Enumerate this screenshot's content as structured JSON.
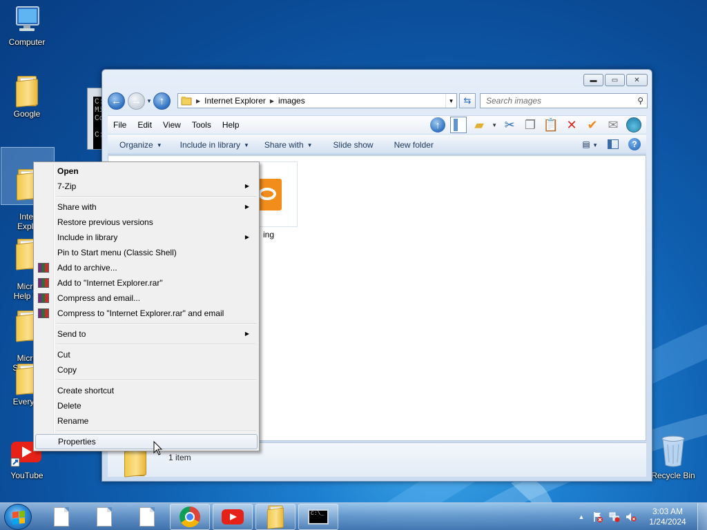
{
  "desktop": {
    "icons": [
      {
        "label": "Computer"
      },
      {
        "label": "Google"
      },
      {
        "label": "Intern\nExplo"
      },
      {
        "label": "Micros\nHelp Vi"
      },
      {
        "label": "Micros\nSQL Se"
      },
      {
        "label": "Everyth"
      },
      {
        "label": "YouTube"
      },
      {
        "label": "Recycle Bin"
      }
    ]
  },
  "console": {
    "text": "C:\\\nMi\nCo\n\nC:"
  },
  "explorer": {
    "window_buttons": {
      "minimize": "▬",
      "maximize": "▭",
      "close": "✕"
    },
    "address": {
      "crumbs": [
        "Internet Explorer",
        "images"
      ]
    },
    "search": {
      "placeholder": "Search images"
    },
    "menu": [
      "File",
      "Edit",
      "View",
      "Tools",
      "Help"
    ],
    "commands": [
      {
        "label": "Organize",
        "dropdown": true
      },
      {
        "label": "Include in library",
        "dropdown": true
      },
      {
        "label": "Share with",
        "dropdown": true
      },
      {
        "label": "Slide show",
        "dropdown": false
      },
      {
        "label": "New folder",
        "dropdown": false
      }
    ],
    "file": {
      "label": "ing"
    },
    "details": {
      "text": "1 item"
    }
  },
  "context_menu": {
    "items": [
      {
        "label": "Open",
        "bold": true
      },
      {
        "label": "7-Zip",
        "submenu": true
      },
      {
        "sep": true
      },
      {
        "label": "Share with",
        "submenu": true
      },
      {
        "label": "Restore previous versions"
      },
      {
        "label": "Include in library",
        "submenu": true
      },
      {
        "label": "Pin to Start menu (Classic Shell)"
      },
      {
        "label": "Add to archive...",
        "icon": "winrar-icon"
      },
      {
        "label": "Add to \"Internet Explorer.rar\"",
        "icon": "winrar-icon"
      },
      {
        "label": "Compress and email...",
        "icon": "winrar-icon"
      },
      {
        "label": "Compress to \"Internet Explorer.rar\" and email",
        "icon": "winrar-icon"
      },
      {
        "sep": true
      },
      {
        "label": "Send to",
        "submenu": true
      },
      {
        "sep": true
      },
      {
        "label": "Cut"
      },
      {
        "label": "Copy"
      },
      {
        "sep": true
      },
      {
        "label": "Create shortcut"
      },
      {
        "label": "Delete"
      },
      {
        "label": "Rename"
      },
      {
        "sep": true
      },
      {
        "label": "Properties",
        "highlighted": true
      }
    ]
  },
  "taskbar": {
    "clock": {
      "time": "3:03 AM",
      "date": "1/24/2024"
    },
    "cmd_text": "C:\\_"
  }
}
